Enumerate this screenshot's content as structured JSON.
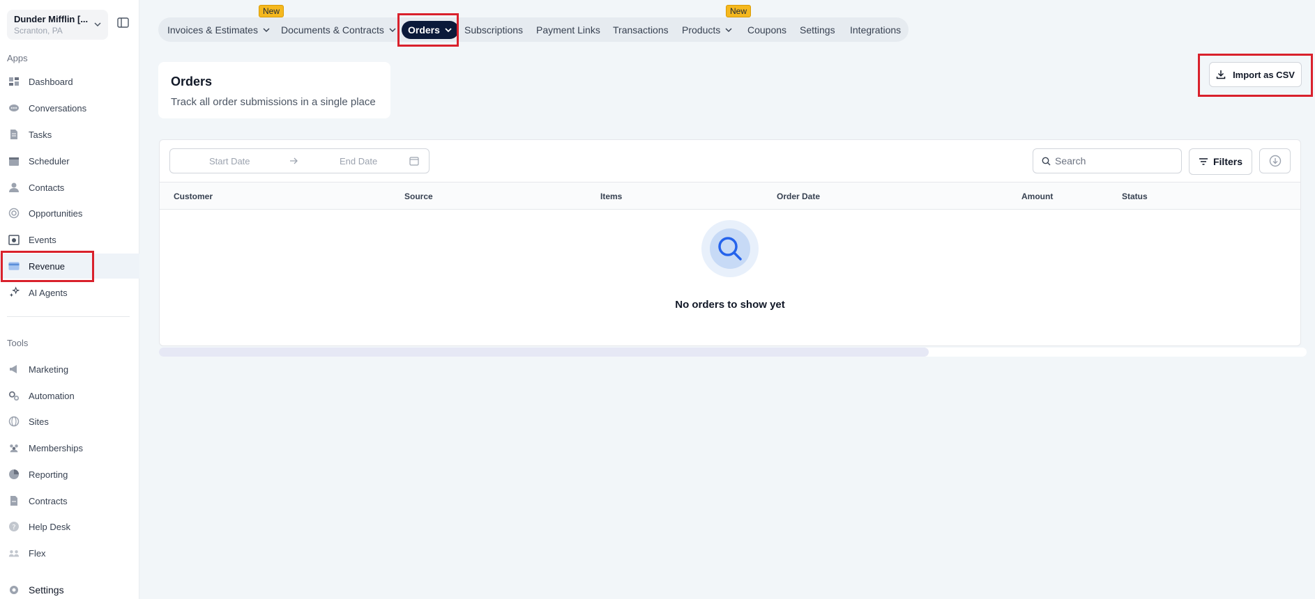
{
  "account": {
    "name": "Dunder Mifflin [...",
    "location": "Scranton, PA"
  },
  "sidebar": {
    "apps_label": "Apps",
    "apps": [
      {
        "label": "Dashboard",
        "icon": "dashboard-icon"
      },
      {
        "label": "Conversations",
        "icon": "chat-icon"
      },
      {
        "label": "Tasks",
        "icon": "document-icon"
      },
      {
        "label": "Scheduler",
        "icon": "calendar-icon"
      },
      {
        "label": "Contacts",
        "icon": "user-icon"
      },
      {
        "label": "Opportunities",
        "icon": "target-icon"
      },
      {
        "label": "Events",
        "icon": "calendar-star-icon"
      },
      {
        "label": "Revenue",
        "icon": "credit-card-icon"
      },
      {
        "label": "AI Agents",
        "icon": "sparkle-icon"
      }
    ],
    "tools_label": "Tools",
    "tools": [
      {
        "label": "Marketing",
        "icon": "megaphone-icon"
      },
      {
        "label": "Automation",
        "icon": "gears-icon"
      },
      {
        "label": "Sites",
        "icon": "globe-icon"
      },
      {
        "label": "Memberships",
        "icon": "users-icon"
      },
      {
        "label": "Reporting",
        "icon": "pie-chart-icon"
      },
      {
        "label": "Contracts",
        "icon": "contract-icon"
      },
      {
        "label": "Help Desk",
        "icon": "help-icon"
      },
      {
        "label": "Flex",
        "icon": "group-icon"
      }
    ],
    "settings_label": "Settings"
  },
  "tabs": [
    {
      "label": "Invoices & Estimates",
      "dropdown": true,
      "badge": "New"
    },
    {
      "label": "Documents & Contracts",
      "dropdown": true
    },
    {
      "label": "Orders",
      "dropdown": true,
      "active": true
    },
    {
      "label": "Subscriptions"
    },
    {
      "label": "Payment Links"
    },
    {
      "label": "Transactions"
    },
    {
      "label": "Products",
      "dropdown": true,
      "badge": "New"
    },
    {
      "label": "Coupons"
    },
    {
      "label": "Settings"
    },
    {
      "label": "Integrations"
    }
  ],
  "header": {
    "title": "Orders",
    "subtitle": "Track all order submissions in a single place"
  },
  "import_button": "Import as CSV",
  "filters": {
    "start_date_placeholder": "Start Date",
    "end_date_placeholder": "End Date",
    "search_placeholder": "Search",
    "filters_label": "Filters"
  },
  "table": {
    "columns": [
      "Customer",
      "Source",
      "Items",
      "Order Date",
      "Amount",
      "Status"
    ],
    "empty_message": "No orders to show yet"
  },
  "colors": {
    "accent_highlight": "#d9212c",
    "active_tab": "#0b1a3a",
    "badge": "#f5b81e"
  }
}
